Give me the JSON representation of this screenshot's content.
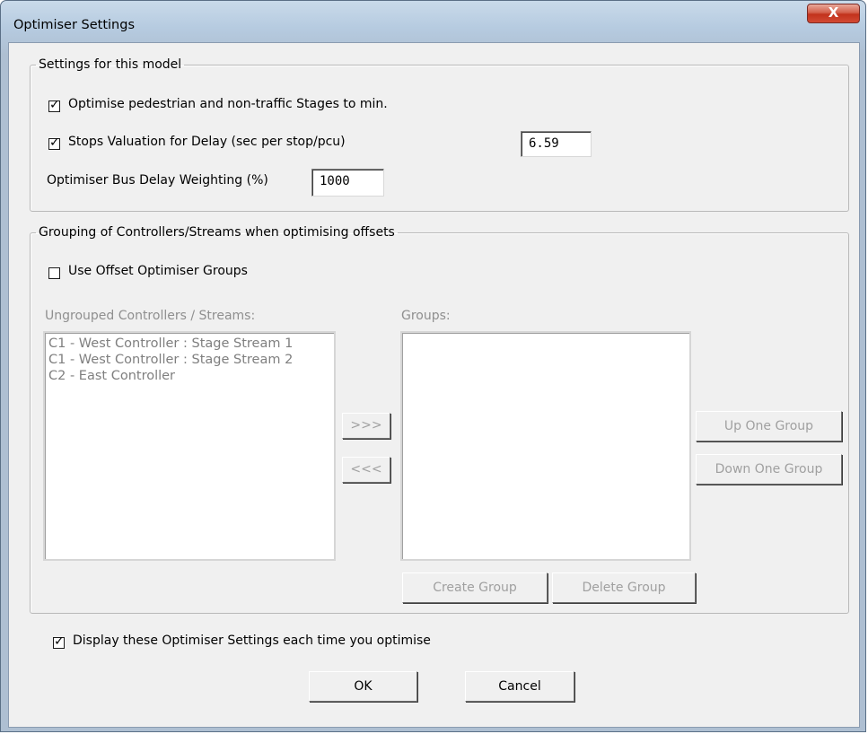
{
  "window": {
    "title": "Optimiser Settings",
    "close_glyph": "X"
  },
  "settings_group": {
    "legend": "Settings for this model",
    "optimise_pedestrian": {
      "label": "Optimise pedestrian and non-traffic Stages to min.",
      "checked": true
    },
    "stops_valuation": {
      "label": "Stops Valuation for Delay (sec per stop/pcu)",
      "checked": true,
      "value": "6.59"
    },
    "bus_delay": {
      "label": "Optimiser Bus Delay Weighting (%)",
      "value": "1000"
    }
  },
  "grouping_group": {
    "legend": "Grouping of Controllers/Streams when optimising offsets",
    "use_groups": {
      "label": "Use Offset Optimiser Groups",
      "checked": false
    },
    "ungrouped_label": "Ungrouped Controllers / Streams:",
    "ungrouped_items": [
      "C1 - West Controller : Stage Stream 1",
      "C1 - West Controller : Stage Stream 2",
      "C2 - East Controller"
    ],
    "groups_label": "Groups:",
    "move_right": ">>>",
    "move_left": "<<<",
    "up_one_group": "Up One Group",
    "down_one_group": "Down One Group",
    "create_group": "Create Group",
    "delete_group": "Delete Group"
  },
  "display_each_time": {
    "label": "Display these Optimiser Settings each time you optimise",
    "checked": true
  },
  "buttons": {
    "ok": "OK",
    "cancel": "Cancel"
  }
}
